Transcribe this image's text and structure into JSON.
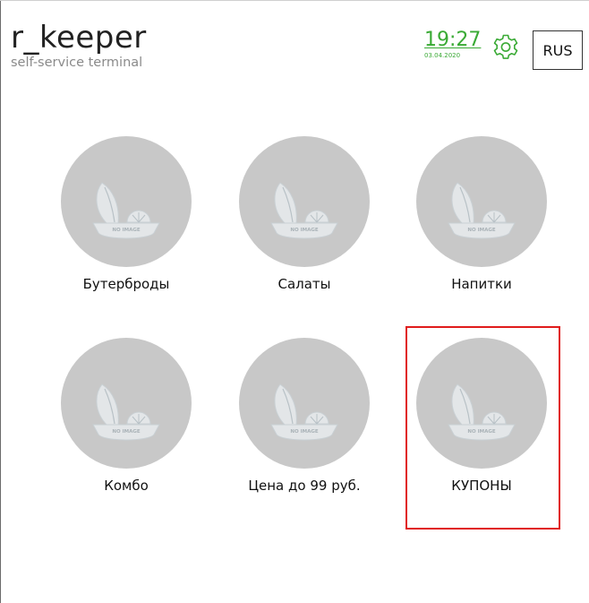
{
  "header": {
    "logo_title": "r_keeper",
    "logo_subtitle": "self-service terminal",
    "clock_time": "19:27",
    "clock_date": "03.04.2020",
    "language_button": "RUS",
    "accent_color": "#3aaa35"
  },
  "categories": [
    {
      "label": "Бутерброды",
      "image_placeholder": "NO IMAGE",
      "icon": "no-image-icon"
    },
    {
      "label": "Салаты",
      "image_placeholder": "NO IMAGE",
      "icon": "no-image-icon"
    },
    {
      "label": "Напитки",
      "image_placeholder": "NO IMAGE",
      "icon": "no-image-icon"
    },
    {
      "label": "Комбо",
      "image_placeholder": "NO IMAGE",
      "icon": "no-image-icon"
    },
    {
      "label": "Цена до 99 руб.",
      "image_placeholder": "NO IMAGE",
      "icon": "no-image-icon"
    },
    {
      "label": "КУПОНЫ",
      "image_placeholder": "NO IMAGE",
      "icon": "no-image-icon",
      "highlighted": true
    }
  ],
  "colors": {
    "highlight_border": "#e01b1b",
    "placeholder_circle": "#c8c8c8"
  }
}
